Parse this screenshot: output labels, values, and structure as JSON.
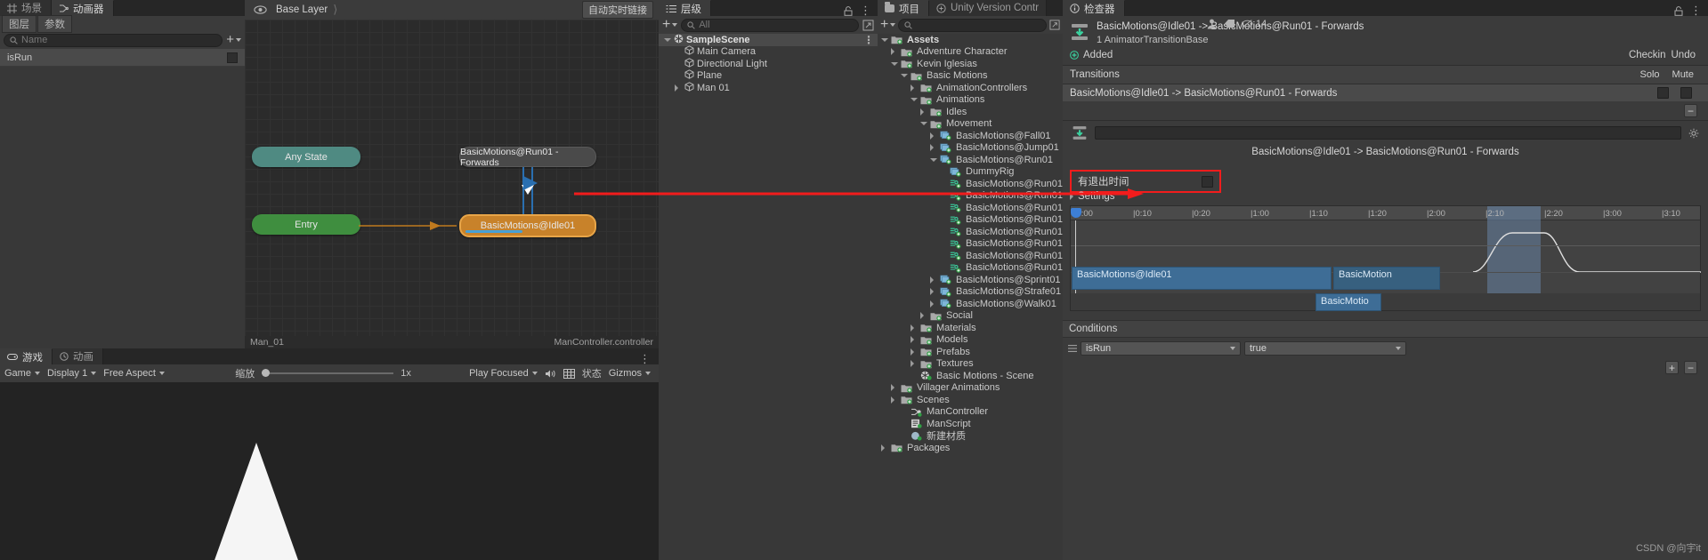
{
  "animator": {
    "tabs": [
      {
        "label": "场景",
        "icon": "grid-icon",
        "active": false
      },
      {
        "label": "动画器",
        "icon": "animator-icon",
        "active": true
      }
    ],
    "subtabs": [
      {
        "label": "图层"
      },
      {
        "label": "参数"
      }
    ],
    "search_placeholder": "Name",
    "add_label": "+",
    "parameters": [
      {
        "name": "isRun",
        "value": "false"
      }
    ],
    "layer_name": "Base Layer",
    "eye_icon": "eye-icon",
    "autolive_label": "自动实时链接",
    "graph_footer_left": "Man_01",
    "graph_footer_right": "ManController.controller",
    "nodes": [
      {
        "id": "any-state",
        "label": "Any State",
        "kind": "anystate"
      },
      {
        "id": "entry",
        "label": "Entry",
        "kind": "entry"
      },
      {
        "id": "run-forwards",
        "label": "BasicMotions@Run01 - Forwards",
        "kind": "state"
      },
      {
        "id": "idle01",
        "label": "BasicMotions@Idle01",
        "kind": "selected"
      }
    ]
  },
  "game": {
    "tabs": [
      {
        "label": "游戏",
        "active": true
      },
      {
        "label": "动画",
        "active": false
      }
    ],
    "title": "Game",
    "display": "Display 1",
    "aspect": "Free Aspect",
    "scale_label": "缩放",
    "scale_value": "1x",
    "play_focused": "Play Focused",
    "mute_icon": "speaker-icon",
    "stats_label": "状态",
    "gizmos_label": "Gizmos",
    "grid_icon": "grid-icon",
    "menu_icon": "kebab-menu-icon"
  },
  "hierarchy": {
    "tab_label": "层级",
    "add_label": "+",
    "search_placeholder": "All",
    "lock_icon": "lock-icon",
    "menu_icon": "kebab-menu-icon",
    "items": [
      {
        "label": "SampleScene",
        "depth": 0,
        "type": "scene",
        "expanded": true
      },
      {
        "label": "Main Camera",
        "depth": 1,
        "type": "gameobject"
      },
      {
        "label": "Directional Light",
        "depth": 1,
        "type": "gameobject"
      },
      {
        "label": "Plane",
        "depth": 1,
        "type": "gameobject"
      },
      {
        "label": "Man 01",
        "depth": 1,
        "type": "gameobject",
        "expandable": true
      }
    ]
  },
  "project": {
    "tabs": [
      {
        "label": "项目",
        "active": true,
        "icon": "folder-icon"
      },
      {
        "label": "Unity Version Contr",
        "active": false,
        "icon": "uvcs-icon"
      }
    ],
    "add_label": "+",
    "search_placeholder": "",
    "badge_count": "14",
    "lock_icon": "lock-icon",
    "menu_icon": "kebab-menu-icon",
    "tree": [
      {
        "label": "Assets",
        "depth": 0,
        "type": "folder",
        "state": "expanded",
        "bold": true
      },
      {
        "label": "Adventure Character",
        "depth": 1,
        "type": "folder",
        "state": "collapsed"
      },
      {
        "label": "Kevin Iglesias",
        "depth": 1,
        "type": "folder",
        "state": "expanded"
      },
      {
        "label": "Basic Motions",
        "depth": 2,
        "type": "folder",
        "state": "expanded"
      },
      {
        "label": "AnimationControllers",
        "depth": 3,
        "type": "folder",
        "state": "collapsed"
      },
      {
        "label": "Animations",
        "depth": 3,
        "type": "folder",
        "state": "expanded"
      },
      {
        "label": "Idles",
        "depth": 4,
        "type": "folder",
        "state": "collapsed"
      },
      {
        "label": "Movement",
        "depth": 4,
        "type": "folder",
        "state": "expanded"
      },
      {
        "label": "BasicMotions@Fall01",
        "depth": 5,
        "type": "model",
        "state": "collapsed"
      },
      {
        "label": "BasicMotions@Jump01",
        "depth": 5,
        "type": "model",
        "state": "collapsed"
      },
      {
        "label": "BasicMotions@Run01",
        "depth": 5,
        "type": "model",
        "state": "expanded"
      },
      {
        "label": "DummyRig",
        "depth": 6,
        "type": "model",
        "state": "none"
      },
      {
        "label": "BasicMotions@Run01 -",
        "depth": 6,
        "type": "anim",
        "state": "none"
      },
      {
        "label": "BasicMotions@Run01 -",
        "depth": 6,
        "type": "anim",
        "state": "none"
      },
      {
        "label": "BasicMotions@Run01 -",
        "depth": 6,
        "type": "anim",
        "state": "none"
      },
      {
        "label": "BasicMotions@Run01 -",
        "depth": 6,
        "type": "anim",
        "state": "none"
      },
      {
        "label": "BasicMotions@Run01 -",
        "depth": 6,
        "type": "anim",
        "state": "none"
      },
      {
        "label": "BasicMotions@Run01 -",
        "depth": 6,
        "type": "anim",
        "state": "none"
      },
      {
        "label": "BasicMotions@Run01 -",
        "depth": 6,
        "type": "anim",
        "state": "none"
      },
      {
        "label": "BasicMotions@Run01 -",
        "depth": 6,
        "type": "anim",
        "state": "none"
      },
      {
        "label": "BasicMotions@Sprint01",
        "depth": 5,
        "type": "model",
        "state": "collapsed"
      },
      {
        "label": "BasicMotions@Strafe01",
        "depth": 5,
        "type": "model",
        "state": "collapsed"
      },
      {
        "label": "BasicMotions@Walk01",
        "depth": 5,
        "type": "model",
        "state": "collapsed"
      },
      {
        "label": "Social",
        "depth": 4,
        "type": "folder",
        "state": "collapsed"
      },
      {
        "label": "Materials",
        "depth": 3,
        "type": "folder",
        "state": "collapsed"
      },
      {
        "label": "Models",
        "depth": 3,
        "type": "folder",
        "state": "collapsed"
      },
      {
        "label": "Prefabs",
        "depth": 3,
        "type": "folder",
        "state": "collapsed"
      },
      {
        "label": "Textures",
        "depth": 3,
        "type": "folder",
        "state": "collapsed"
      },
      {
        "label": "Basic Motions - Scene",
        "depth": 3,
        "type": "scene",
        "state": "none"
      },
      {
        "label": "Villager Animations",
        "depth": 1,
        "type": "folder",
        "state": "collapsed"
      },
      {
        "label": "Scenes",
        "depth": 1,
        "type": "folder",
        "state": "collapsed"
      },
      {
        "label": "ManController",
        "depth": 2,
        "type": "controller",
        "state": "none"
      },
      {
        "label": "ManScript",
        "depth": 2,
        "type": "script",
        "state": "none"
      },
      {
        "label": "新建材质",
        "depth": 2,
        "type": "material",
        "state": "none"
      },
      {
        "label": "Packages",
        "depth": 0,
        "type": "folder",
        "state": "collapsed"
      }
    ]
  },
  "inspector": {
    "tab_label": "检查器",
    "lock_icon": "lock-icon",
    "menu_icon": "kebab-menu-icon",
    "title": "BasicMotions@Idle01 -> BasicMotions@Run01 - Forwards",
    "subtitle": "1 AnimatorTransitionBase",
    "added_label": "Added",
    "checkin_label": "Checkin",
    "undo_label": "Undo",
    "transitions_label": "Transitions",
    "solo_label": "Solo",
    "mute_label": "Mute",
    "transition_row": "BasicMotions@Idle01 -> BasicMotions@Run01 - Forwards",
    "minus_label": "−",
    "motion_field_value": "",
    "transition_name": "BasicMotions@Idle01 -> BasicMotions@Run01 - Forwards",
    "has_exit_time_label": "有退出时间",
    "settings_label": "Settings",
    "timeline_ticks": [
      "0:00",
      "0:10",
      "0:20",
      "1:00",
      "1:10",
      "1:20",
      "2:00",
      "2:10",
      "2:20",
      "3:00",
      "3:10"
    ],
    "clip_source": "BasicMotions@Idle01",
    "clip_dest_full": "BasicMotion",
    "clip_dest_partial": "BasicMotio",
    "conditions_label": "Conditions",
    "condition_parameter": "isRun",
    "condition_value": "true",
    "add_condition_label": "+",
    "remove_condition_label": "−"
  },
  "watermark": "CSDN @向宇it",
  "colors": {
    "accent_orange": "#c8822a",
    "entry_green": "#3f8e3f",
    "anystate_teal": "#4f8a82",
    "annotation_red": "#f21c1c",
    "clip_blue": "#3e6d96"
  }
}
